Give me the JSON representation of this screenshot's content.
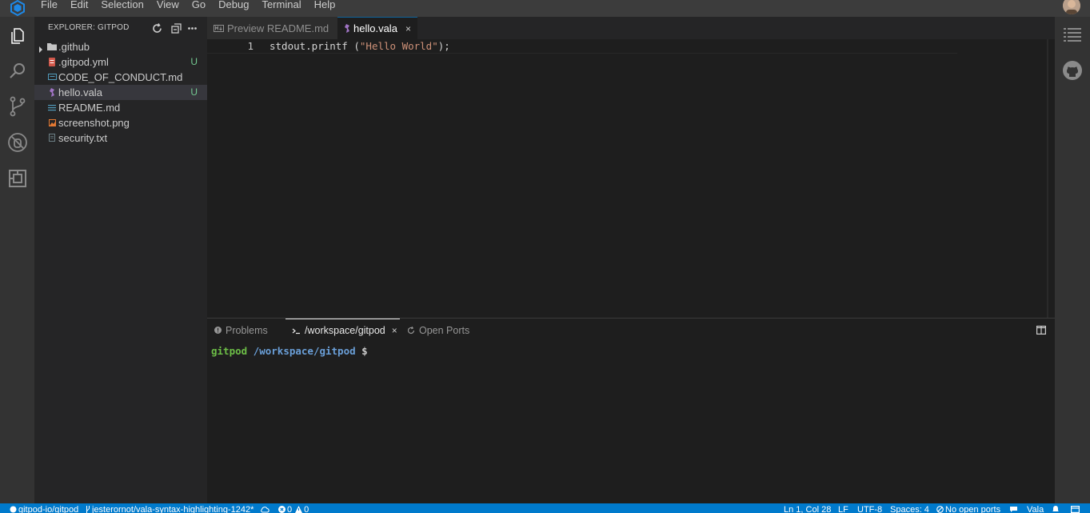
{
  "menubar": {
    "items": [
      "File",
      "Edit",
      "Selection",
      "View",
      "Go",
      "Debug",
      "Terminal",
      "Help"
    ]
  },
  "activitybar": {
    "icons": [
      "files-icon",
      "search-icon",
      "source-control-icon",
      "debug-icon",
      "extensions-icon"
    ]
  },
  "sidebar": {
    "title": "EXPLORER: GITPOD",
    "files": [
      {
        "name": ".github",
        "kind": "folder",
        "badge": ""
      },
      {
        "name": ".gitpod.yml",
        "kind": "yaml",
        "badge": "U"
      },
      {
        "name": "CODE_OF_CONDUCT.md",
        "kind": "markdown",
        "badge": ""
      },
      {
        "name": "hello.vala",
        "kind": "vala",
        "badge": "U"
      },
      {
        "name": "README.md",
        "kind": "markdown",
        "badge": ""
      },
      {
        "name": "screenshot.png",
        "kind": "image",
        "badge": ""
      },
      {
        "name": "security.txt",
        "kind": "text",
        "badge": ""
      }
    ]
  },
  "tabs": [
    {
      "label": "Preview README.md",
      "active": false
    },
    {
      "label": "hello.vala",
      "active": true,
      "close": "×"
    }
  ],
  "editor": {
    "line_number": "1",
    "code_prefix": "stdout.printf (",
    "code_string": "\"Hello World\"",
    "code_suffix": ");"
  },
  "panel": {
    "tabs": [
      {
        "label": "Problems",
        "active": false
      },
      {
        "label": "/workspace/gitpod",
        "active": true,
        "close": "×"
      },
      {
        "label": "Open Ports",
        "active": false
      }
    ],
    "terminal": {
      "user": "gitpod",
      "path": "/workspace/gitpod",
      "prompt": "$"
    }
  },
  "statusbar": {
    "repo": "gitpod-io/gitpod",
    "branch": "jesterornot/vala-syntax-highlighting-1242*",
    "errors": "0",
    "warnings": "0",
    "position": "Ln 1, Col 28",
    "eol": "LF",
    "encoding": "UTF-8",
    "indent": "Spaces: 4",
    "ports": "No open ports",
    "language": "Vala"
  },
  "colors": {
    "accent": "#007acc",
    "untracked": "#73c991",
    "string": "#ce9178",
    "terminal_user": "#6dbf47",
    "terminal_path": "#6a9fd8"
  }
}
